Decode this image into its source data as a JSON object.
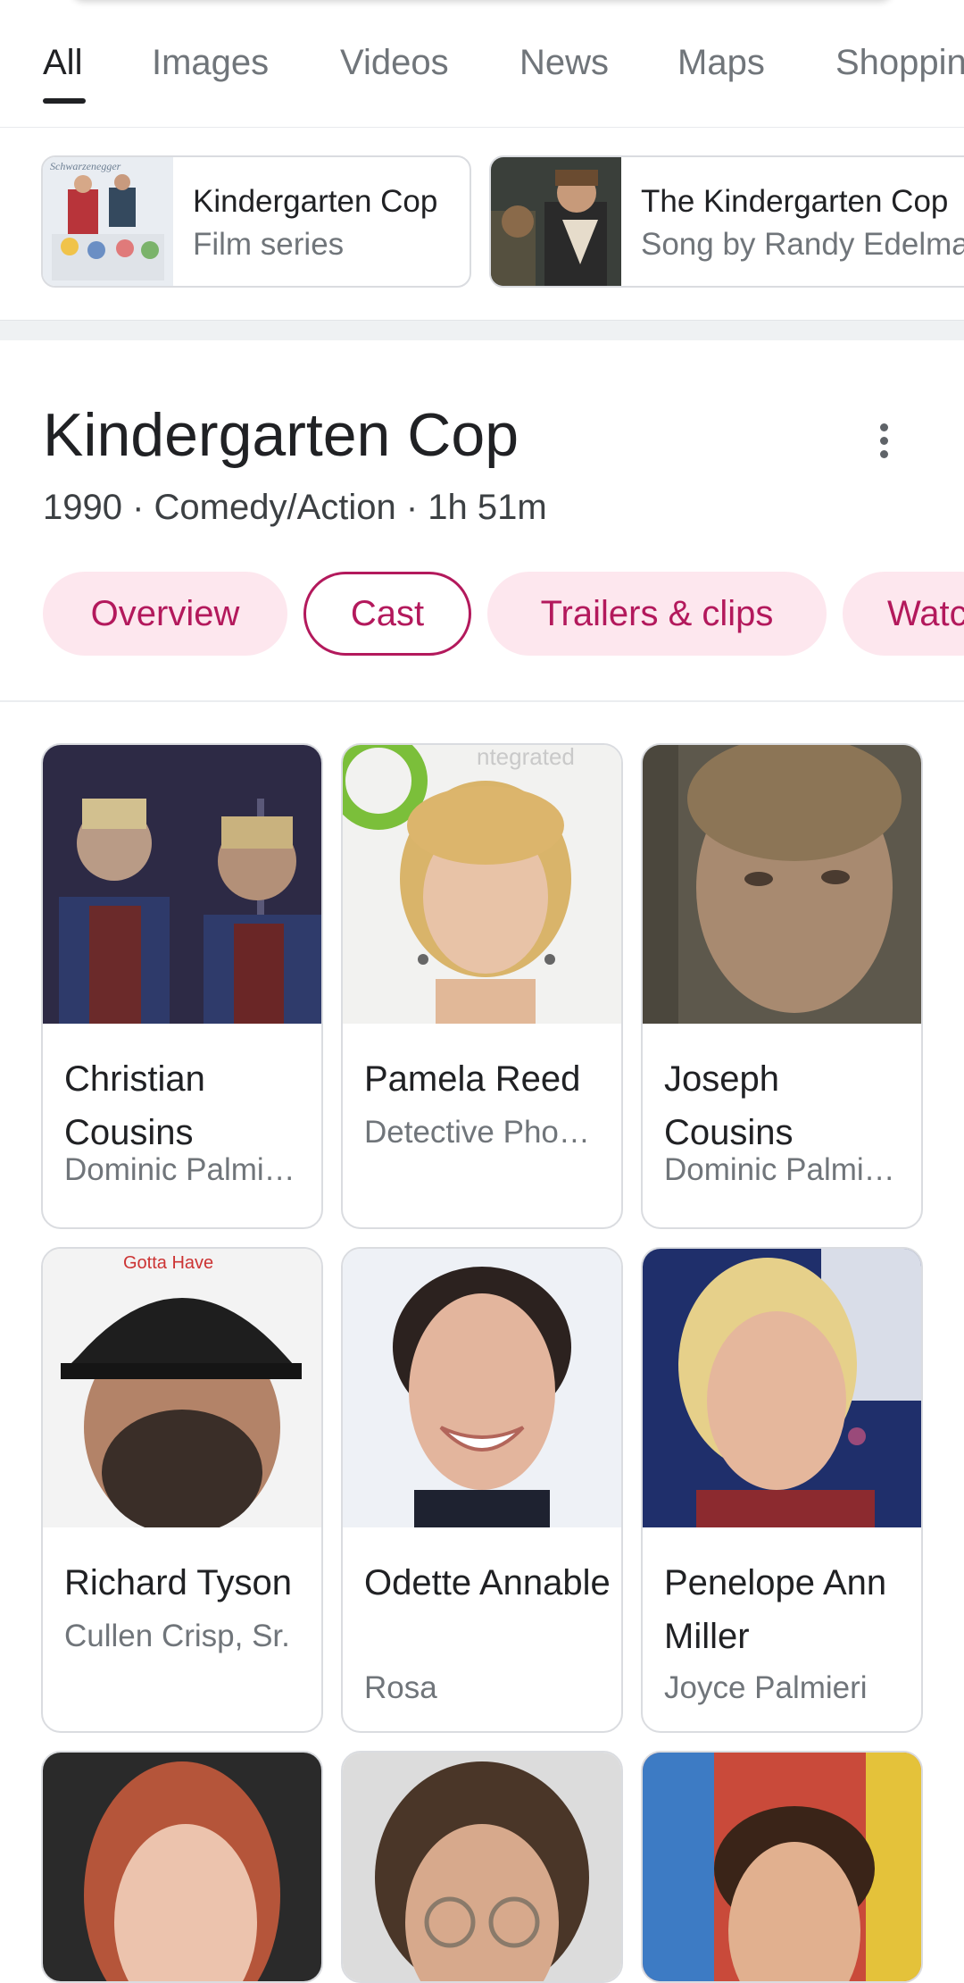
{
  "tabs": [
    "All",
    "Images",
    "Videos",
    "News",
    "Maps",
    "Shoppin"
  ],
  "related": [
    {
      "title": "Kindergarten Cop",
      "subtitle": "Film series",
      "thumb_text": "Schwarzenegger"
    },
    {
      "title": "The Kindergarten Cop",
      "subtitle": "Song by Randy Edelma"
    }
  ],
  "movie": {
    "title": "Kindergarten Cop",
    "meta": "1990 · Comedy/Action · 1h 51m"
  },
  "pills": [
    "Overview",
    "Cast",
    "Trailers & clips",
    "Watc"
  ],
  "cast": [
    {
      "name": "Christian Cousins",
      "role": "Dominic Palmi…"
    },
    {
      "name": "Pamela Reed",
      "role": "Detective Pho…"
    },
    {
      "name": "Joseph Cousins",
      "role": "Dominic Palmi…"
    },
    {
      "name": "Richard Tyson",
      "role": "Cullen Crisp, Sr."
    },
    {
      "name": "Odette Annable",
      "role": "Rosa"
    },
    {
      "name": "Penelope Ann Miller",
      "role": "Joyce Palmieri"
    }
  ],
  "colors": {
    "accent": "#b3195c",
    "pill_bg": "#fde7ee",
    "muted": "#70757a"
  }
}
